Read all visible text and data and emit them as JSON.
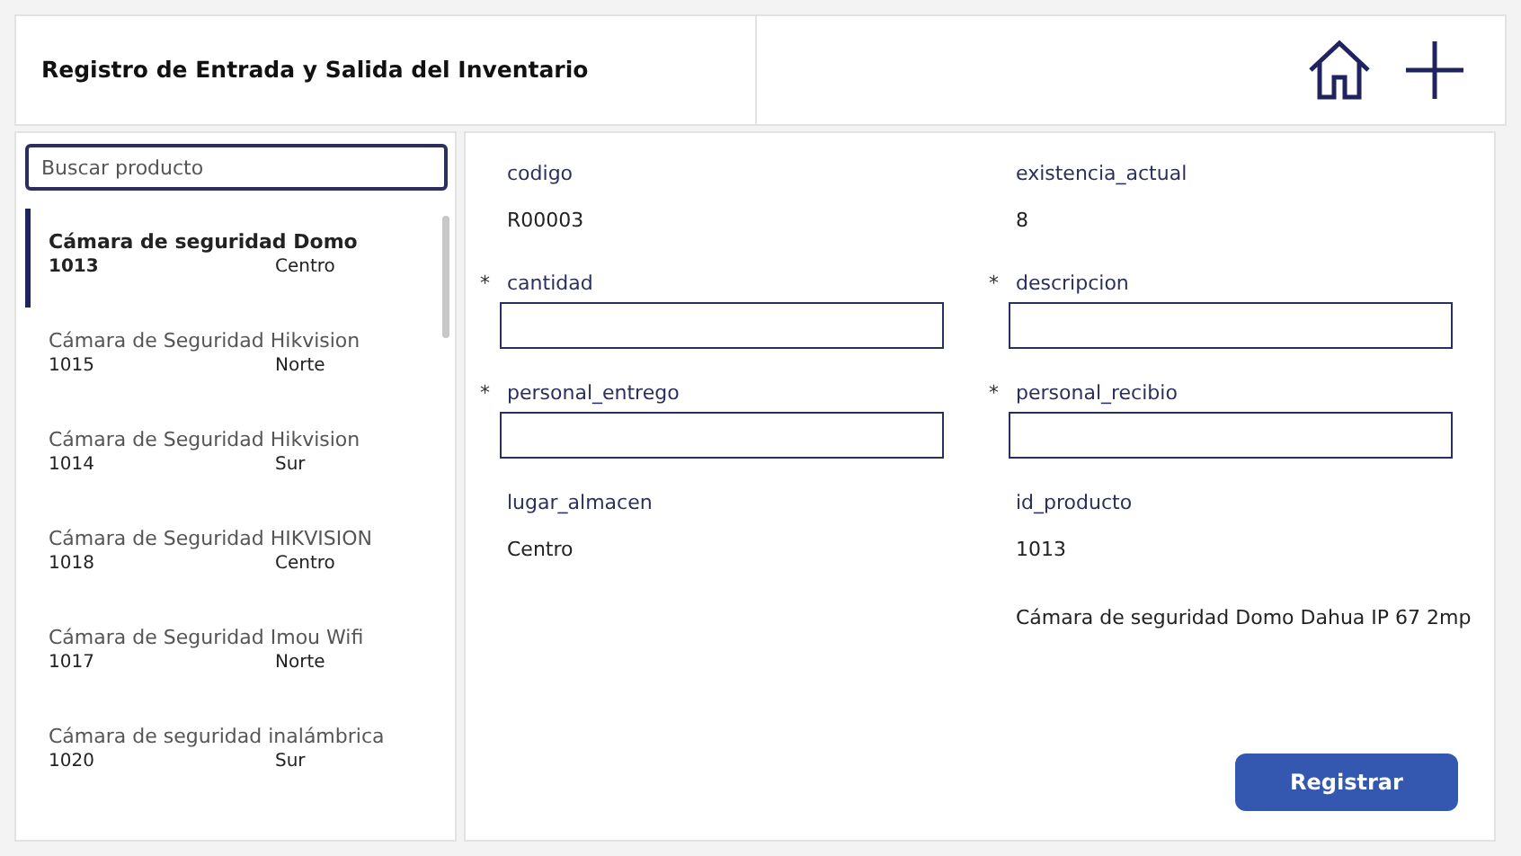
{
  "header": {
    "title": "Registro de Entrada y Salida del Inventario"
  },
  "search": {
    "placeholder": "Buscar producto"
  },
  "products": [
    {
      "name": "Cámara de seguridad Domo",
      "id": "1013",
      "location": "Centro",
      "selected": true
    },
    {
      "name": "Cámara de Seguridad Hikvision",
      "id": "1015",
      "location": "Norte",
      "selected": false
    },
    {
      "name": "Cámara de Seguridad Hikvision",
      "id": "1014",
      "location": "Sur",
      "selected": false
    },
    {
      "name": "Cámara de Seguridad HIKVISION",
      "id": "1018",
      "location": "Centro",
      "selected": false
    },
    {
      "name": "Cámara de Seguridad Imou Wifi",
      "id": "1017",
      "location": "Norte",
      "selected": false
    },
    {
      "name": "Cámara de seguridad inalámbrica",
      "id": "1020",
      "location": "Sur",
      "selected": false
    }
  ],
  "form": {
    "left": [
      {
        "kind": "display",
        "label": "codigo",
        "value": "R00003"
      },
      {
        "kind": "input",
        "label": "cantidad",
        "required": "*"
      },
      {
        "kind": "input",
        "label": "personal_entrego",
        "required": "*"
      },
      {
        "kind": "display",
        "label": "lugar_almacen",
        "value": "Centro"
      }
    ],
    "right": [
      {
        "kind": "display",
        "label": "existencia_actual",
        "value": "8"
      },
      {
        "kind": "input",
        "label": "descripcion",
        "required": "*"
      },
      {
        "kind": "input",
        "label": "personal_recibio",
        "required": "*"
      },
      {
        "kind": "display",
        "label": "id_producto",
        "value": "1013"
      },
      {
        "kind": "text",
        "value": "Cámara de seguridad Domo Dahua IP 67 2mp"
      }
    ]
  },
  "submit": "Registrar"
}
